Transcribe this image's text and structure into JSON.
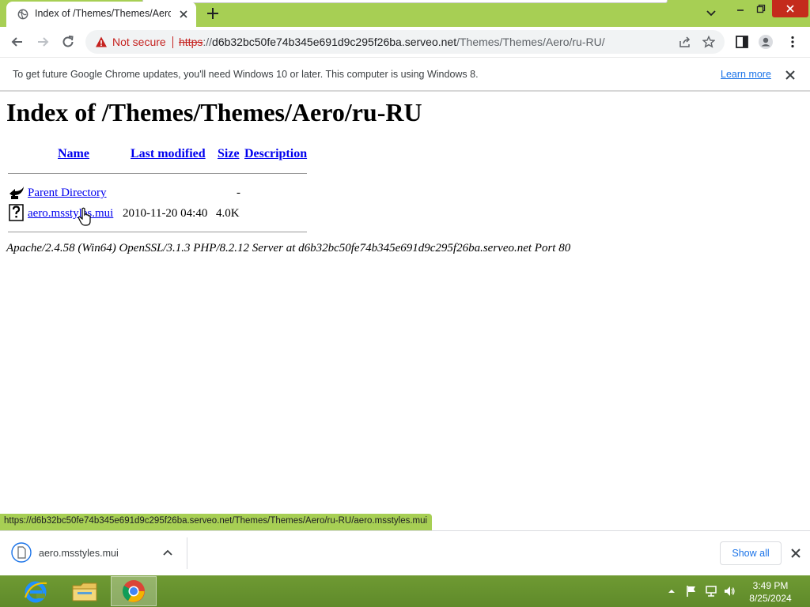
{
  "browser": {
    "tab": {
      "title": "Index of /Themes/Themes/Aero/"
    },
    "omnibox": {
      "security_label": "Not secure",
      "url_scheme": "https",
      "url_colon": "://",
      "url_host": "d6b32bc50fe74b345e691d9c295f26ba.serveo.net",
      "url_path": "/Themes/Themes/Aero/ru-RU/"
    },
    "infobar": {
      "message": "To get future Google Chrome updates, you'll need Windows 10 or later. This computer is using Windows 8.",
      "learn_more": "Learn more"
    },
    "status_bubble": "https://d6b32bc50fe74b345e691d9c295f26ba.serveo.net/Themes/Themes/Aero/ru-RU/aero.msstyles.mui"
  },
  "page": {
    "heading": "Index of /Themes/Themes/Aero/ru-RU",
    "columns": {
      "name": "Name",
      "last_modified": "Last modified",
      "size": "Size",
      "description": "Description"
    },
    "rows": [
      {
        "name": "Parent Directory",
        "last_modified": "",
        "size": "-",
        "icon": "back-folder-icon"
      },
      {
        "name": "aero.msstyles.mui",
        "last_modified": "2010-11-20 04:40",
        "size": "4.0K",
        "icon": "unknown-file-icon"
      }
    ],
    "address": "Apache/2.4.58 (Win64) OpenSSL/3.1.3 PHP/8.2.12 Server at d6b32bc50fe74b345e691d9c295f26ba.serveo.net Port 80"
  },
  "downloads": {
    "item_name": "aero.msstyles.mui",
    "show_all": "Show all"
  },
  "taskbar": {
    "time": "3:49 PM",
    "date": "8/25/2024",
    "apps": [
      "internet-explorer-icon",
      "file-explorer-icon",
      "chrome-icon"
    ]
  },
  "colors": {
    "frame": "#a7cf54",
    "link": "#0000ee",
    "not_secure": "#c5221f",
    "taskbar": "#6f9a33"
  }
}
